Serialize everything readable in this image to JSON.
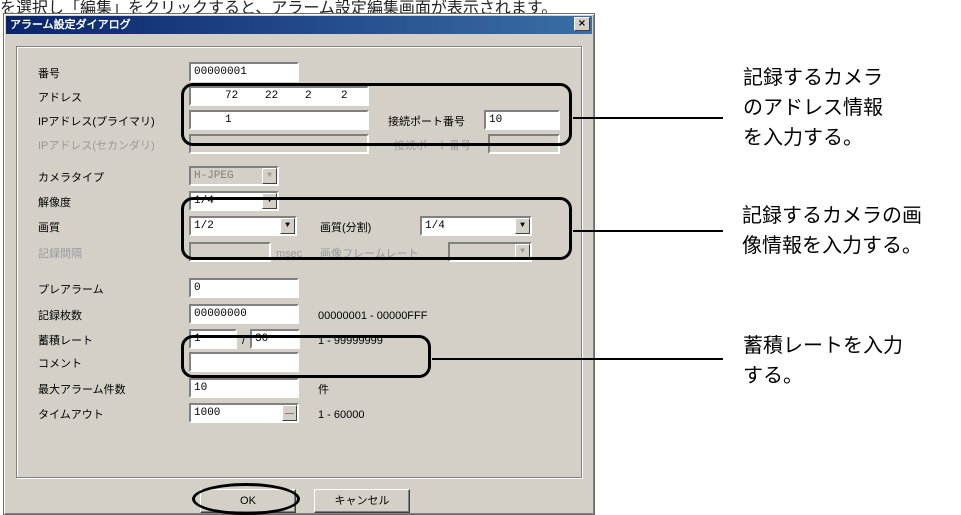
{
  "caption": "を選択し「編集」をクリックすると、アラーム設定編集画面が表示されます。",
  "dialog": {
    "title": "アラーム設定ダイアログ",
    "close": "×",
    "rows": {
      "number": {
        "label": "番号",
        "value": "00000001"
      },
      "address": {
        "label": "アドレス",
        "values": [
          "72",
          "22",
          "2",
          "2"
        ]
      },
      "primary_ip": {
        "label": "IPアドレス(プライマリ)",
        "value": "1",
        "port_label": "接続ポート番号",
        "port_value": "10"
      },
      "secondary_ip": {
        "label": "IPアドレス(セカンダリ)",
        "value": "",
        "port_label": "接続ポート番号",
        "port_value": ""
      },
      "camera_type": {
        "label": "カメラタイプ",
        "value": "H-JPEG"
      },
      "resolution": {
        "label": "解像度",
        "value": "1/4"
      },
      "quality": {
        "label": "画質",
        "value": "1/2",
        "second_label": "画質(分割)",
        "second_value": "1/4"
      },
      "interval": {
        "label": "記録間隔",
        "value": "",
        "unit": "msec",
        "second_label": "画像フレームレート",
        "second_value": ""
      },
      "pre_alarm": {
        "label": "プレアラーム",
        "value": "0"
      },
      "record_count": {
        "label": "記録枚数",
        "value": "00000000",
        "range": "00000001 - 00000FFF"
      },
      "rate": {
        "label": "蓄積レート",
        "value1": "1",
        "sep": "/",
        "value2": "30",
        "range": "1 - 99999999"
      },
      "comment": {
        "label": "コメント",
        "value": ""
      },
      "max_alarm": {
        "label": "最大アラーム件数",
        "value": "10",
        "unit": "件"
      },
      "timeout": {
        "label": "タイムアウト",
        "value": "1000",
        "range": "1 - 60000"
      }
    },
    "buttons": {
      "ok": "OK",
      "cancel": "キャンセル"
    }
  },
  "annotations": {
    "address_note": [
      "記録するカメラ",
      "のアドレス情報",
      "を入力する。"
    ],
    "image_note": [
      "記録するカメラの画",
      "像情報を入力する。"
    ],
    "rate_note": [
      "蓄積レートを入力",
      "する。"
    ]
  }
}
